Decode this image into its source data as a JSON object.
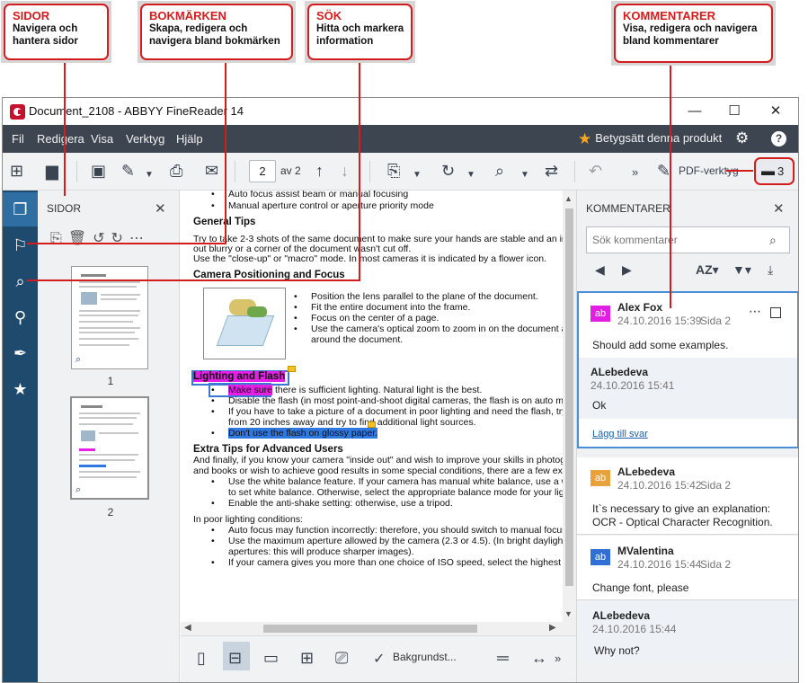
{
  "callouts": {
    "sidor": {
      "title": "SIDOR",
      "desc": "Navigera och hantera sidor"
    },
    "bokmarken": {
      "title": "BOKMÄRKEN",
      "desc": "Skapa, redigera och navigera bland bokmärken"
    },
    "sok": {
      "title": "SÖK",
      "desc": "Hitta och markera information"
    },
    "kommentarer": {
      "title": "KOMMENTARER",
      "desc": "Visa, redigera och navigera bland kommentarer"
    }
  },
  "window": {
    "title": "Document_2108 - ABBYY FineReader 14",
    "minimize": "—",
    "maximize": "☐",
    "close": "✕"
  },
  "menu": {
    "items": [
      "Fil",
      "Redigera",
      "Visa",
      "Verktyg",
      "Hjälp"
    ],
    "rate": "Betygsätt denna produkt"
  },
  "toolbar": {
    "page_current": "2",
    "page_total": "av 2",
    "pdf_tools": "PDF-verktyg",
    "comment_count": "3"
  },
  "sidebar": {
    "pages_title": "SIDOR",
    "thumbs": [
      "1",
      "2"
    ]
  },
  "document": {
    "lines_top": [
      "Auto focus assist beam or manual focusing",
      "Manual aperture control or aperture priority mode"
    ],
    "general_tips": "General Tips",
    "general_p1": "Try to take 2-3 shots of the same document to make sure your hands are stable and an imag",
    "general_p2": "out blurry or a corner of the document wasn't cut off.",
    "general_p3": "Use the \"close-up\" or \"macro\" mode. In most cameras it is indicated by a flower icon.",
    "camera_head": "Camera Positioning and Focus",
    "camera_bullets": [
      "Position the lens parallel to the plane of the document.",
      "Fit the entire document into the frame.",
      "Focus on the center of a page.",
      "Use the camera's optical zoom to zoom in on the document and",
      "around the document."
    ],
    "lighting_head": "Lighting and Flash",
    "lighting_b1_hl": "Make sure",
    "lighting_b1_rest": " there is sufficient lighting. Natural light is the best.",
    "lighting_b2": "Disable the flash (in most point-and-shoot digital cameras, the flash is on auto mode",
    "lighting_b3": "If you have to take a picture of a document in poor lighting and need the flash, try to",
    "lighting_b3b": "from 20 inches away and try to find additional light sources.",
    "lighting_b4": "Don't use the flash on glossy paper.",
    "extra_head": "Extra Tips for Advanced Users",
    "extra_p1": "And finally, if you know your camera \"inside out\" and wish to improve your skills in photograp",
    "extra_p2": "and books or wish to achieve good results in some special conditions, there are a few extra t",
    "extra_b1": "Use the white balance feature. If your camera has manual white balance, use a white",
    "extra_b1b": "to set white balance. Otherwise, select the appropriate balance mode for your lightin",
    "extra_b2": "Enable the anti-shake setting: otherwise, use a tripod.",
    "poor_head": "In poor lighting conditions:",
    "poor_b1": "Auto focus may function incorrectly: therefore, you should switch to manual focus.",
    "poor_b2": "Use the maximum aperture allowed by the camera (2.3 or 4.5). (In bright daylight, us",
    "poor_b2b": "apertures: this will produce sharper images).",
    "poor_b3": "If your camera gives you more than one choice of ISO speed, select the highest ISO"
  },
  "bottom": {
    "background_label": "Bakgrundst..."
  },
  "comments": {
    "title": "KOMMENTARER",
    "search_placeholder": "Sök kommentarer",
    "cards": [
      {
        "initials": "ab",
        "color": "#e21ee2",
        "author": "Alex Fox",
        "date": "24.10.2016 15:39",
        "page": "Sida 2",
        "text": "Should add some examples.",
        "reply_author": "ALebedeva",
        "reply_date": "24.10.2016 15:41",
        "reply_text": "Ok",
        "add_reply": "Lägg till svar"
      },
      {
        "initials": "ab",
        "color": "#e8a23a",
        "author": "ALebedeva",
        "date": "24.10.2016 15:42",
        "page": "Sida 2",
        "text1": "It`s necessary to give an explanation:",
        "text2": "OCR - Optical Character Recognition."
      },
      {
        "initials": "ab",
        "color": "#2f6fd6",
        "author": "MValentina",
        "date": "24.10.2016 15:44",
        "page": "Sida 2",
        "text": "Change font, please"
      },
      {
        "author": "ALebedeva",
        "date": "24.10.2016 15:44",
        "text": "Why not?"
      }
    ]
  }
}
